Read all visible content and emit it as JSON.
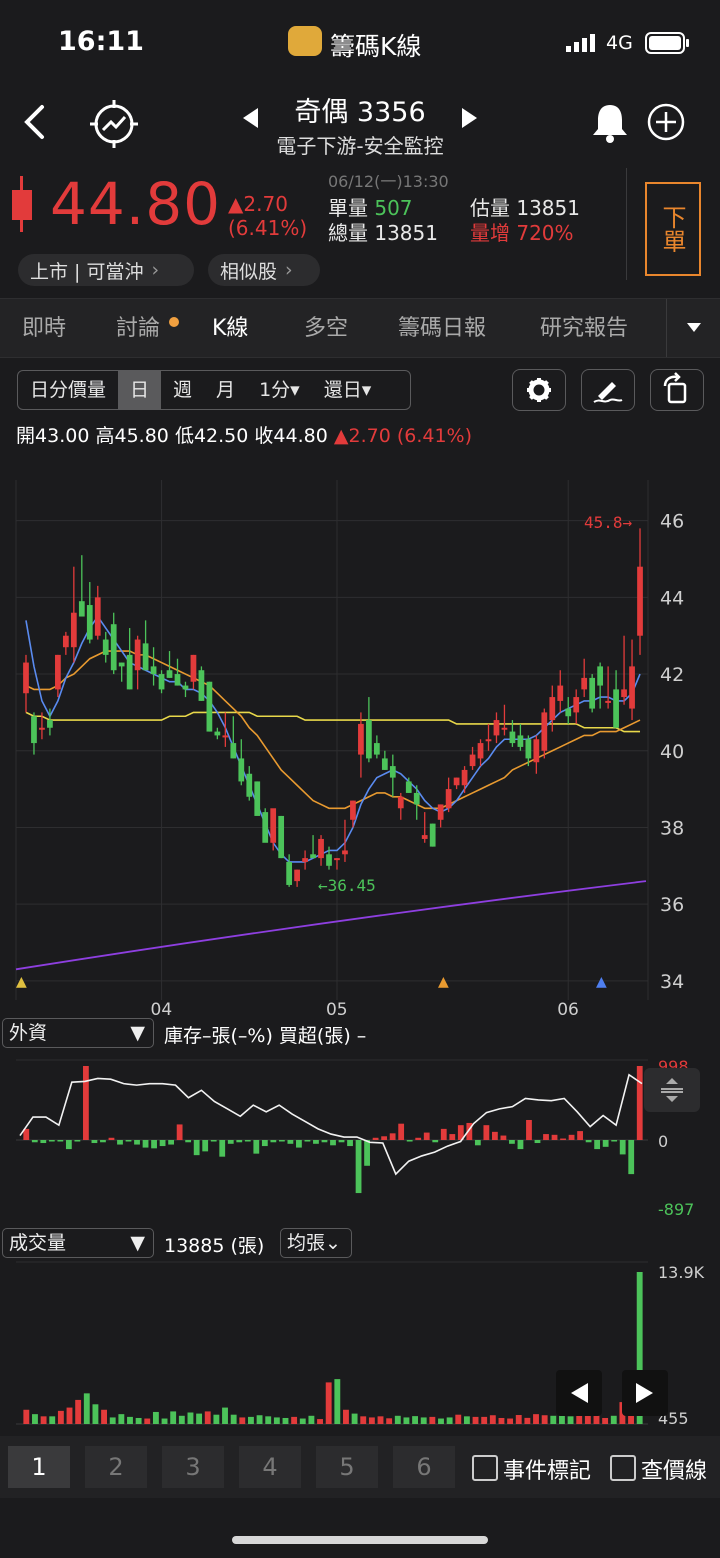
{
  "status": {
    "time": "16:11",
    "app_name": "籌碼K線",
    "network": "4G"
  },
  "header": {
    "stock_name_code": "奇偶 3356",
    "industry": "電子下游-安全監控"
  },
  "quote": {
    "price": "44.80",
    "change": "▲2.70",
    "change_pct": "(6.41%)",
    "datetime": "06/12(一)13:30",
    "tick_vol_label": "單量",
    "tick_vol": "507",
    "total_vol_label": "總量",
    "total_vol": "13851",
    "est_vol_label": "估量",
    "est_vol": "13851",
    "vol_up_label": "量增",
    "vol_up": "720%",
    "market_label": "上市 | 可當沖",
    "similar_label": "相似股",
    "order_button": "下單",
    "accent_red": "#e23b3b",
    "accent_green": "#4cc35a",
    "order_border": "#e9862d"
  },
  "tabs": [
    "即時",
    "討論",
    "K線",
    "多空",
    "籌碼日報",
    "研究報告"
  ],
  "active_tab": "K線",
  "toolbar": {
    "segments": [
      "日分價量",
      "日",
      "週",
      "月",
      "1分▾",
      "還日▾"
    ],
    "active_segment": "日"
  },
  "ohlc": {
    "open_label": "開",
    "open": "43.00",
    "high_label": "高",
    "high": "45.80",
    "low_label": "低",
    "low": "42.50",
    "close_label": "收",
    "close": "44.80",
    "change": "▲2.70 (6.41%)"
  },
  "chart_data": [
    {
      "type": "candlestick",
      "y_ticks": [
        "46",
        "44",
        "42",
        "40",
        "38",
        "36",
        "34"
      ],
      "ylim": [
        33.5,
        46.8
      ],
      "x_ticks": [
        "04",
        "05",
        "06"
      ],
      "annotations": {
        "high": "45.8→",
        "low": "←36.45"
      },
      "candles": [
        [
          41.5,
          42.5,
          41,
          42.3
        ],
        [
          40.9,
          41,
          39.9,
          40.2
        ],
        [
          40.6,
          41,
          40.3,
          40.6
        ],
        [
          40.8,
          41.1,
          40.4,
          40.6
        ],
        [
          41.6,
          42.5,
          41.4,
          42.5
        ],
        [
          42.7,
          43.1,
          42.5,
          43
        ],
        [
          42.7,
          44.8,
          42.3,
          43.6
        ],
        [
          43.9,
          45.1,
          43.7,
          43.5
        ],
        [
          43.8,
          44.4,
          42.8,
          42.9
        ],
        [
          43,
          44.3,
          42.9,
          44
        ],
        [
          42.9,
          43.1,
          42.3,
          42.5
        ],
        [
          43.3,
          43.6,
          42,
          42.1
        ],
        [
          42.3,
          42.3,
          41.8,
          42.2
        ],
        [
          42.5,
          43.2,
          41.6,
          41.6
        ],
        [
          42.1,
          43,
          41.6,
          42.9
        ],
        [
          42.8,
          43.4,
          42.1,
          42.1
        ],
        [
          42.2,
          42.7,
          41.7,
          42
        ],
        [
          42,
          42.1,
          41.5,
          41.6
        ],
        [
          42.1,
          42.6,
          41.9,
          41.9
        ],
        [
          42,
          42.4,
          41.7,
          41.7
        ],
        [
          41.7,
          41.8,
          41.4,
          41.6
        ],
        [
          41.8,
          42.5,
          41.6,
          42.5
        ],
        [
          42.1,
          42.2,
          41.3,
          41.3
        ],
        [
          41.8,
          41.8,
          40.5,
          40.5
        ],
        [
          40.5,
          40.6,
          40.3,
          40.4
        ],
        [
          40.4,
          41,
          40.1,
          40.4
        ],
        [
          40.2,
          40.9,
          39.8,
          39.8
        ],
        [
          39.8,
          40.3,
          39.1,
          39.2
        ],
        [
          39.4,
          39.6,
          38.7,
          38.8
        ],
        [
          39.2,
          39.2,
          38.7,
          38.3
        ],
        [
          38.4,
          38.5,
          37.7,
          37.6
        ],
        [
          37.6,
          38.4,
          37.4,
          38.5
        ],
        [
          38.3,
          38.3,
          37.2,
          37.2
        ],
        [
          37.1,
          37.3,
          36.45,
          36.5
        ],
        [
          36.6,
          36.9,
          36.45,
          36.9
        ],
        [
          37.1,
          37.4,
          36.9,
          37.2
        ],
        [
          37.3,
          37.8,
          37.2,
          37.2
        ],
        [
          37.2,
          37.8,
          37,
          37.7
        ],
        [
          37.3,
          37.5,
          36.9,
          37
        ],
        [
          37.2,
          37.2,
          36.9,
          37.2
        ],
        [
          37.3,
          38.2,
          37.1,
          37.4
        ],
        [
          38.2,
          38.7,
          38,
          38.7
        ],
        [
          39.9,
          41,
          39.3,
          40.7
        ],
        [
          40.8,
          41.4,
          39.7,
          39.8
        ],
        [
          40.2,
          40.4,
          39.8,
          39.9
        ],
        [
          39.8,
          40,
          39.5,
          39.5
        ],
        [
          39.6,
          39.9,
          38.8,
          39.3
        ],
        [
          38.5,
          38.9,
          38.2,
          38.8
        ],
        [
          39.2,
          39.3,
          38.9,
          38.9
        ],
        [
          38.9,
          39.1,
          38.2,
          38.6
        ],
        [
          37.7,
          38.4,
          37.6,
          37.8
        ],
        [
          38.1,
          38.1,
          37.5,
          37.5
        ],
        [
          38.2,
          38.6,
          38,
          38.6
        ],
        [
          38.5,
          39.3,
          38.4,
          39
        ],
        [
          39.1,
          39.3,
          39,
          39.3
        ],
        [
          39.1,
          39.6,
          38.9,
          39.5
        ],
        [
          39.6,
          40.1,
          39.5,
          39.9
        ],
        [
          39.8,
          40.3,
          39.6,
          40.2
        ],
        [
          40.3,
          40.7,
          40,
          40.3
        ],
        [
          40.4,
          41,
          40.2,
          40.8
        ],
        [
          40.6,
          41.2,
          40.4,
          40.6
        ],
        [
          40.5,
          40.8,
          40.1,
          40.2
        ],
        [
          40.4,
          40.7,
          40,
          40.1
        ],
        [
          40.3,
          40.4,
          39.6,
          39.8
        ],
        [
          39.7,
          40.4,
          39.4,
          40.3
        ],
        [
          40,
          41.1,
          39.8,
          41
        ],
        [
          40.8,
          41.7,
          40.5,
          41.4
        ],
        [
          41.3,
          42.1,
          41,
          41.7
        ],
        [
          41.1,
          41.4,
          40.7,
          40.9
        ],
        [
          41,
          41.6,
          40.7,
          41.4
        ],
        [
          41.6,
          42.4,
          41.4,
          41.9
        ],
        [
          41.9,
          42,
          41,
          41.1
        ],
        [
          42.2,
          42.3,
          41.1,
          41.7
        ],
        [
          41.3,
          42.2,
          41.1,
          41.3
        ],
        [
          41.6,
          42.1,
          40.6,
          40.6
        ],
        [
          41.4,
          43,
          41.2,
          41.6
        ],
        [
          41.1,
          42.9,
          40.8,
          42.2
        ],
        [
          43,
          45.8,
          42.5,
          44.8
        ]
      ],
      "ma5": [
        43.4,
        42.2,
        41.3,
        40.9,
        41.3,
        41.9,
        42.3,
        42.8,
        43.2,
        43.5,
        43.2,
        42.9,
        42.6,
        42.3,
        42.2,
        42.1,
        42.0,
        41.9,
        41.8,
        41.8,
        41.6,
        41.6,
        41.5,
        41.3,
        41.0,
        40.6,
        40.1,
        39.6,
        39.1,
        38.6,
        38.1,
        37.6,
        37.3,
        37.1,
        37.1,
        37.1,
        37.2,
        37.3,
        37.4,
        37.4,
        37.6,
        38.0,
        38.6,
        39.0,
        39.3,
        39.4,
        39.5,
        39.4,
        39.2,
        39.0,
        38.7,
        38.5,
        38.4,
        38.5,
        38.7,
        39.0,
        39.3,
        39.6,
        39.8,
        40.1,
        40.3,
        40.3,
        40.3,
        40.3,
        40.4,
        40.6,
        40.8,
        41.0,
        41.1,
        41.2,
        41.3,
        41.3,
        41.4,
        41.4,
        41.3,
        41.3,
        41.5,
        42.0
      ],
      "ma20": [
        41.7,
        41.6,
        41.6,
        41.6,
        41.7,
        41.9,
        42.0,
        42.2,
        42.4,
        42.5,
        42.6,
        42.6,
        42.6,
        42.6,
        42.5,
        42.5,
        42.4,
        42.3,
        42.2,
        42.1,
        42.0,
        41.9,
        41.8,
        41.7,
        41.5,
        41.3,
        41.1,
        40.9,
        40.6,
        40.4,
        40.1,
        39.8,
        39.5,
        39.3,
        39.1,
        38.9,
        38.7,
        38.6,
        38.5,
        38.5,
        38.5,
        38.6,
        38.7,
        38.8,
        38.9,
        38.9,
        38.8,
        38.8,
        38.7,
        38.6,
        38.5,
        38.5,
        38.5,
        38.6,
        38.7,
        38.8,
        38.9,
        39.0,
        39.1,
        39.2,
        39.3,
        39.5,
        39.6,
        39.7,
        39.8,
        39.9,
        40.0,
        40.1,
        40.2,
        40.3,
        40.4,
        40.4,
        40.5,
        40.5,
        40.5,
        40.6,
        40.7,
        40.8
      ],
      "ma60": [
        41,
        40.9,
        40.9,
        40.8,
        40.8,
        40.8,
        40.8,
        40.8,
        40.8,
        40.8,
        40.8,
        40.8,
        40.8,
        40.8,
        40.8,
        40.8,
        40.8,
        40.8,
        40.9,
        40.9,
        40.9,
        41.0,
        41.0,
        41.0,
        41.0,
        41.0,
        41.0,
        41.0,
        41.0,
        40.9,
        40.9,
        40.9,
        40.9,
        40.9,
        40.9,
        40.8,
        40.8,
        40.8,
        40.8,
        40.8,
        40.8,
        40.8,
        40.8,
        40.8,
        40.8,
        40.8,
        40.8,
        40.8,
        40.8,
        40.8,
        40.8,
        40.8,
        40.8,
        40.8,
        40.7,
        40.7,
        40.7,
        40.7,
        40.7,
        40.7,
        40.7,
        40.7,
        40.7,
        40.7,
        40.7,
        40.7,
        40.7,
        40.7,
        40.7,
        40.7,
        40.6,
        40.6,
        40.6,
        40.6,
        40.6,
        40.5,
        40.5,
        40.5
      ],
      "ma240_start": 34.3,
      "ma240_end": 36.6,
      "line_colors": {
        "ma5": "#5a8bf0",
        "ma20": "#e89a30",
        "ma60": "#e8d84a",
        "ma240": "#8e3fe0"
      }
    },
    {
      "type": "bar",
      "selector": "外資",
      "legend": "庫存–張(–%) 買超(張) –",
      "y_ticks": {
        "top": "998",
        "mid": "0",
        "bottom": "-897"
      },
      "ylim": [
        -897,
        998
      ],
      "values": [
        150,
        -30,
        -40,
        -10,
        -10,
        -120,
        -20,
        998,
        -40,
        -30,
        30,
        -60,
        -20,
        -60,
        -100,
        -110,
        -80,
        -60,
        210,
        -30,
        -200,
        -150,
        -20,
        -220,
        -50,
        -30,
        -10,
        -180,
        -80,
        -30,
        -10,
        -50,
        -100,
        -20,
        -50,
        -30,
        -70,
        -30,
        -80,
        -700,
        -340,
        30,
        50,
        90,
        220,
        -20,
        30,
        100,
        -30,
        150,
        80,
        200,
        230,
        -70,
        200,
        110,
        60,
        -50,
        -120,
        270,
        -40,
        80,
        70,
        20,
        70,
        120,
        -30,
        -120,
        -90,
        -10,
        -190,
        -450,
        998
      ],
      "line": [
        60,
        310,
        310,
        200,
        780,
        790,
        830,
        820,
        760,
        740,
        760,
        760,
        740,
        570,
        670,
        520,
        420,
        320,
        470,
        380,
        470,
        350,
        250,
        150,
        80,
        40,
        40,
        -30,
        -40,
        -450,
        -280,
        -210,
        -160,
        -80,
        -20,
        220,
        370,
        420,
        450,
        560,
        540,
        530,
        560,
        380,
        180,
        330,
        200,
        880,
        760
      ]
    },
    {
      "type": "bar",
      "selector": "成交量",
      "total": "13885 (張)",
      "mode": "均張⌄",
      "y_ticks": {
        "top": "13.9K",
        "bottom": "455"
      },
      "ylim": [
        455,
        13885
      ],
      "values": [
        1300,
        900,
        700,
        700,
        1200,
        1500,
        2200,
        2800,
        1800,
        1300,
        600,
        900,
        650,
        550,
        500,
        1100,
        500,
        1150,
        750,
        1050,
        950,
        1150,
        850,
        1500,
        850,
        600,
        650,
        800,
        700,
        600,
        550,
        650,
        500,
        750,
        450,
        3800,
        4100,
        1300,
        950,
        700,
        600,
        700,
        520,
        750,
        600,
        720,
        600,
        650,
        500,
        600,
        850,
        700,
        650,
        650,
        800,
        550,
        500,
        820,
        560,
        900,
        800,
        750,
        1350,
        700,
        1000,
        750,
        1300,
        550,
        750,
        2000,
        1150,
        13885
      ]
    },
    {
      "type": "bar_colors",
      "candles_up": "#e23b3b",
      "candles_down": "#4cc35a"
    }
  ],
  "markers": {
    "left": "▲",
    "middle": "▲",
    "right": "▲"
  },
  "pages": [
    "1",
    "2",
    "3",
    "4",
    "5",
    "6"
  ],
  "active_page": "1",
  "checkbox_events": "事件標記",
  "checkbox_price_line": "查價線"
}
